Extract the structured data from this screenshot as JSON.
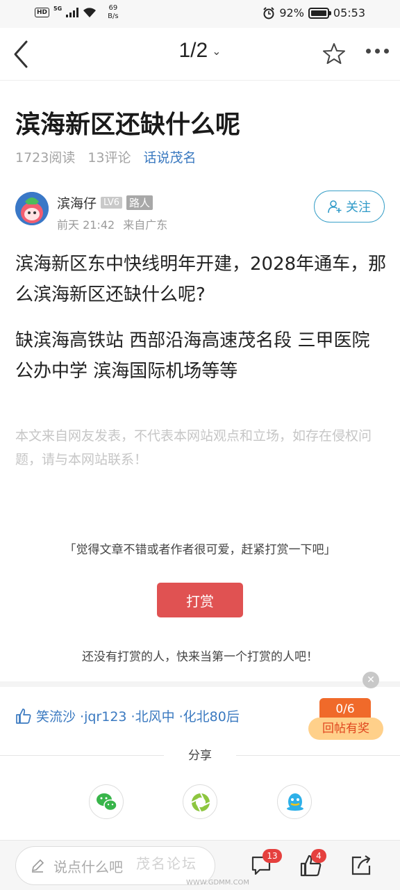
{
  "status_bar": {
    "hd": "HD",
    "network": "5G",
    "speed_value": "69",
    "speed_unit": "B/s",
    "battery": "92%",
    "time": "05:53"
  },
  "nav": {
    "page_indicator": "1/2"
  },
  "article": {
    "title": "滨海新区还缺什么呢",
    "reads": "1723阅读",
    "comments": "13评论",
    "forum": "话说茂名",
    "author": {
      "name": "滨海仔",
      "level": "LV6",
      "rank": "路人",
      "time": "前天 21:42",
      "source": "来自广东",
      "follow_label": "关注"
    },
    "paragraphs": [
      "滨海新区东中快线明年开建，2028年通车，那么滨海新区还缺什么呢?",
      "缺滨海高铁站 西部沿海高速茂名段 三甲医院 公办中学 滨海国际机场等等"
    ],
    "disclaimer": "本文来自网友发表，不代表本网站观点和立场，如存在侵权问题，请与本网站联系！"
  },
  "reward": {
    "tip": "「觉得文章不错或者作者很可爱，赶紧打赏一下吧」",
    "button_label": "打赏",
    "empty_text": "还没有打赏的人，快来当第一个打赏的人吧！"
  },
  "likes": {
    "users": "笑流沙 ·jqr123 ·北风中 ·化北80后"
  },
  "reply_reward": {
    "progress": "0/6",
    "label": "回帖有奖"
  },
  "share": {
    "label": "分享",
    "targets": [
      "wechat-icon",
      "moments-icon",
      "qq-icon"
    ]
  },
  "bottom_bar": {
    "comment_placeholder": "说点什么吧",
    "comment_count": "13",
    "like_count": "4"
  },
  "watermark": {
    "text": "茂名论坛",
    "url": "WWW.GDMM.COM"
  },
  "colors": {
    "accent_blue": "#3a79c0",
    "reward_red": "#e05252",
    "badge_red": "#e5403e",
    "follow_teal": "#2f9ac8"
  }
}
